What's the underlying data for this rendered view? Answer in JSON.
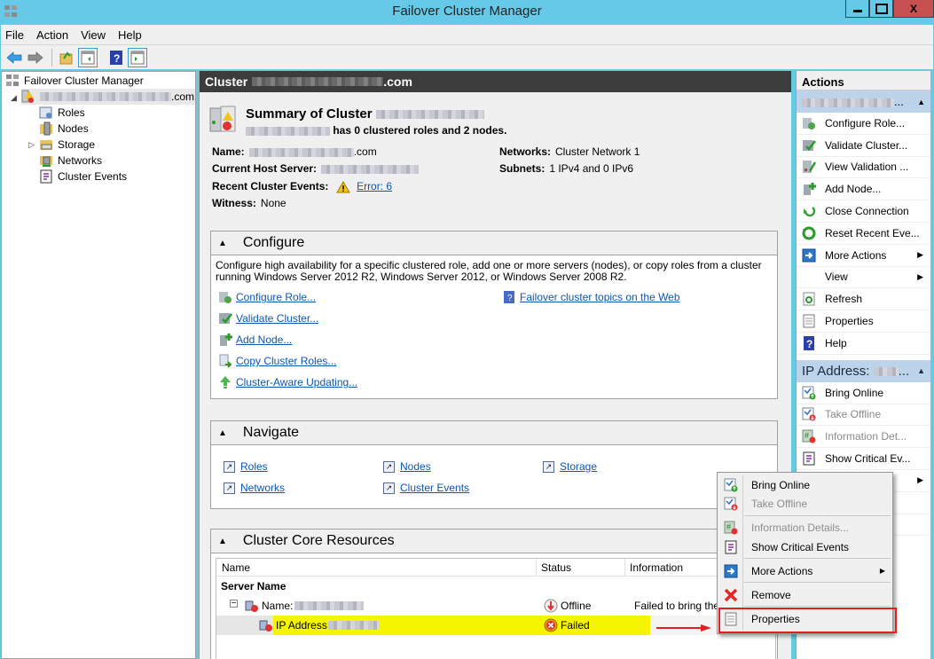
{
  "window": {
    "title": "Failover Cluster Manager",
    "controls": {
      "minimize": "minimize",
      "maximize": "maximize",
      "close": "X"
    }
  },
  "menubar": [
    "File",
    "Action",
    "View",
    "Help"
  ],
  "toolbar": [
    "back-icon",
    "forward-icon",
    "up-folder-icon",
    "show-hide-console-tree-icon",
    "help-icon",
    "show-hide-action-pane-icon"
  ],
  "tree": {
    "root": "Failover Cluster Manager",
    "cluster_suffix": ".com",
    "children": [
      "Roles",
      "Nodes",
      "Storage",
      "Networks",
      "Cluster Events"
    ]
  },
  "center": {
    "header_prefix": "Cluster",
    "header_suffix": ".com",
    "summary": {
      "title_prefix": "Summary of Cluster",
      "subtitle": "has 0 clustered roles and 2 nodes.",
      "name_label": "Name:",
      "name_suffix": ".com",
      "host_label": "Current Host Server:",
      "events_label": "Recent Cluster Events:",
      "events_link": "Error: 6",
      "witness_label": "Witness:",
      "witness_value": "None",
      "networks_label": "Networks:",
      "networks_value": "Cluster Network 1",
      "subnets_label": "Subnets:",
      "subnets_value": "1 IPv4 and 0 IPv6"
    },
    "configure": {
      "title": "Configure",
      "description": "Configure high availability for a specific clustered role, add one or more servers (nodes), or copy roles from a cluster running Windows Server 2012 R2, Windows Server 2012, or Windows Server 2008 R2.",
      "links": [
        "Configure Role...",
        "Validate Cluster...",
        "Add Node...",
        "Copy Cluster Roles...",
        "Cluster-Aware Updating..."
      ],
      "web_link": "Failover cluster topics on the Web"
    },
    "navigate": {
      "title": "Navigate",
      "links": [
        "Roles",
        "Nodes",
        "Storage",
        "Networks",
        "Cluster Events"
      ]
    },
    "core_resources": {
      "title": "Cluster Core Resources",
      "columns": [
        "Name",
        "Status",
        "Information"
      ],
      "group": "Server Name",
      "rows": [
        {
          "name": "Name:",
          "status": "Offline",
          "information": "Failed to bring the r"
        },
        {
          "name": "IP Address:",
          "status": "Failed",
          "information": ""
        }
      ]
    }
  },
  "actions": {
    "title": "Actions",
    "cluster_items": [
      {
        "label": "Configure Role...",
        "icon": "configure-role-icon"
      },
      {
        "label": "Validate Cluster...",
        "icon": "validate-cluster-icon"
      },
      {
        "label": "View Validation ...",
        "icon": "view-validation-icon"
      },
      {
        "label": "Add Node...",
        "icon": "add-node-icon"
      },
      {
        "label": "Close Connection",
        "icon": "close-connection-icon"
      },
      {
        "label": "Reset Recent Eve...",
        "icon": "reset-events-icon"
      },
      {
        "label": "More Actions",
        "icon": "more-actions-icon"
      },
      {
        "label": "View",
        "icon": ""
      },
      {
        "label": "Refresh",
        "icon": "refresh-icon"
      },
      {
        "label": "Properties",
        "icon": "properties-icon"
      },
      {
        "label": "Help",
        "icon": "help-icon"
      }
    ],
    "ip_group": "IP Address:",
    "ip_items": [
      {
        "label": "Bring Online",
        "disabled": false
      },
      {
        "label": "Take Offline",
        "disabled": true
      },
      {
        "label": "Information Det...",
        "disabled": true
      },
      {
        "label": "Show Critical Ev...",
        "disabled": false
      }
    ]
  },
  "context_menu": {
    "items": [
      {
        "label": "Bring Online",
        "disabled": false
      },
      {
        "label": "Take Offline",
        "disabled": true
      },
      {
        "label": "Information Details...",
        "disabled": true
      },
      {
        "label": "Show Critical Events",
        "disabled": false
      },
      {
        "label": "More Actions",
        "disabled": false
      },
      {
        "label": "Remove",
        "disabled": false
      },
      {
        "label": "Properties",
        "disabled": false
      }
    ]
  },
  "colors": {
    "titlebar": "#66c9e8",
    "close_button": "#c75050",
    "selection_highlight": "#f5f500",
    "link": "#0a57b4",
    "annotation_red": "#e02020"
  }
}
